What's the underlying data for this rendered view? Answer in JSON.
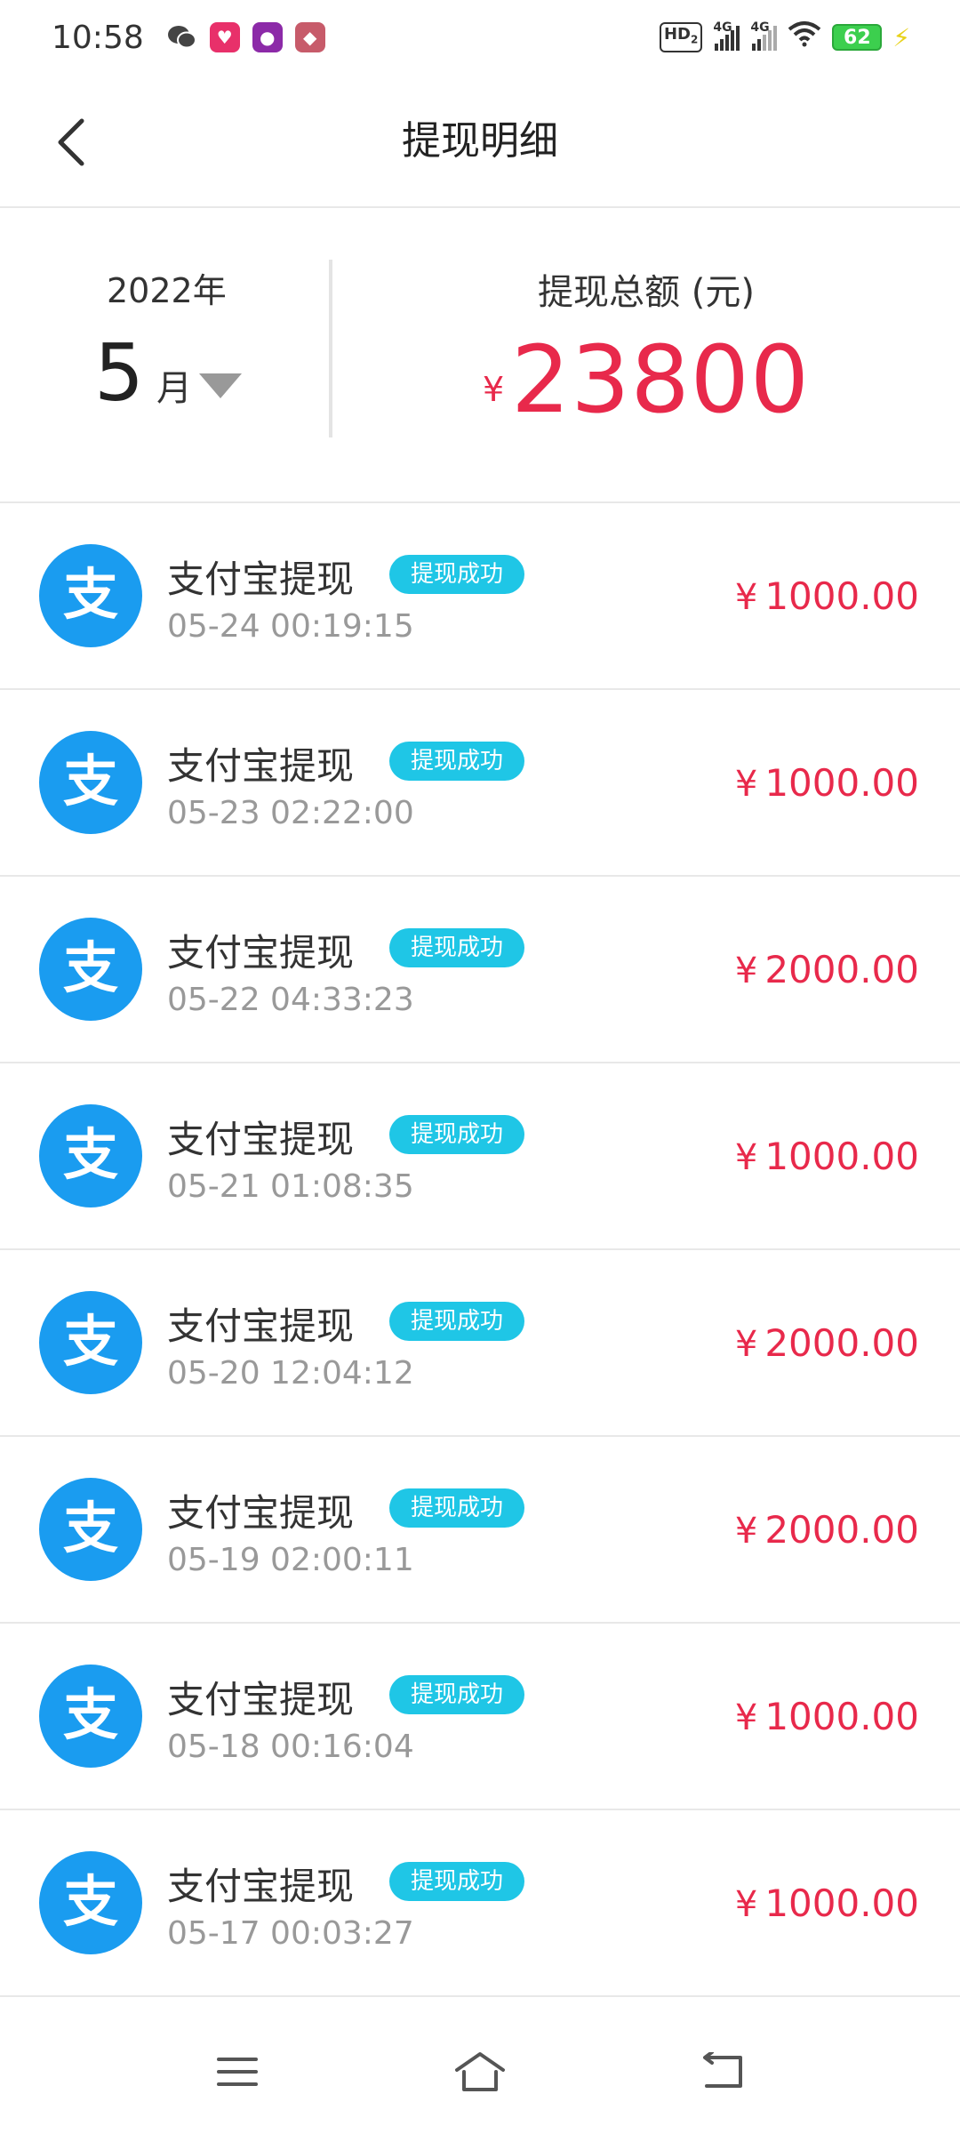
{
  "status_bar": {
    "time": "10:58",
    "notification_icons": [
      "wechat-icon",
      "app-icon",
      "app-icon",
      "app-icon"
    ],
    "hd_label": "HD",
    "hd_sub": "2",
    "signal1_label": "4G",
    "signal2_label": "4G",
    "battery_level": "62"
  },
  "header": {
    "back_icon": "back-arrow-icon",
    "title": "提现明细"
  },
  "summary": {
    "year": "2022年",
    "month_number": "5",
    "month_unit": "月",
    "total_label": "提现总额 (元)",
    "currency_symbol": "¥",
    "total_amount": "23800"
  },
  "records": [
    {
      "title": "支付宝提现",
      "status": "提现成功",
      "time": "05-24 00:19:15",
      "currency": "¥",
      "amount": "1000.00"
    },
    {
      "title": "支付宝提现",
      "status": "提现成功",
      "time": "05-23 02:22:00",
      "currency": "¥",
      "amount": "1000.00"
    },
    {
      "title": "支付宝提现",
      "status": "提现成功",
      "time": "05-22 04:33:23",
      "currency": "¥",
      "amount": "2000.00"
    },
    {
      "title": "支付宝提现",
      "status": "提现成功",
      "time": "05-21 01:08:35",
      "currency": "¥",
      "amount": "1000.00"
    },
    {
      "title": "支付宝提现",
      "status": "提现成功",
      "time": "05-20 12:04:12",
      "currency": "¥",
      "amount": "2000.00"
    },
    {
      "title": "支付宝提现",
      "status": "提现成功",
      "time": "05-19 02:00:11",
      "currency": "¥",
      "amount": "2000.00"
    },
    {
      "title": "支付宝提现",
      "status": "提现成功",
      "time": "05-18 00:16:04",
      "currency": "¥",
      "amount": "1000.00"
    },
    {
      "title": "支付宝提现",
      "status": "提现成功",
      "time": "05-17 00:03:27",
      "currency": "¥",
      "amount": "1000.00"
    }
  ],
  "record_icon": {
    "name": "alipay-icon",
    "glyph": "支",
    "color": "#1a9cf0"
  },
  "nav_bar": {
    "icons": [
      "menu-icon",
      "home-icon",
      "back-icon"
    ]
  },
  "colors": {
    "accent_red": "#e8294b",
    "badge_cyan": "#1fc6e6",
    "alipay_blue": "#1a9cf0"
  }
}
